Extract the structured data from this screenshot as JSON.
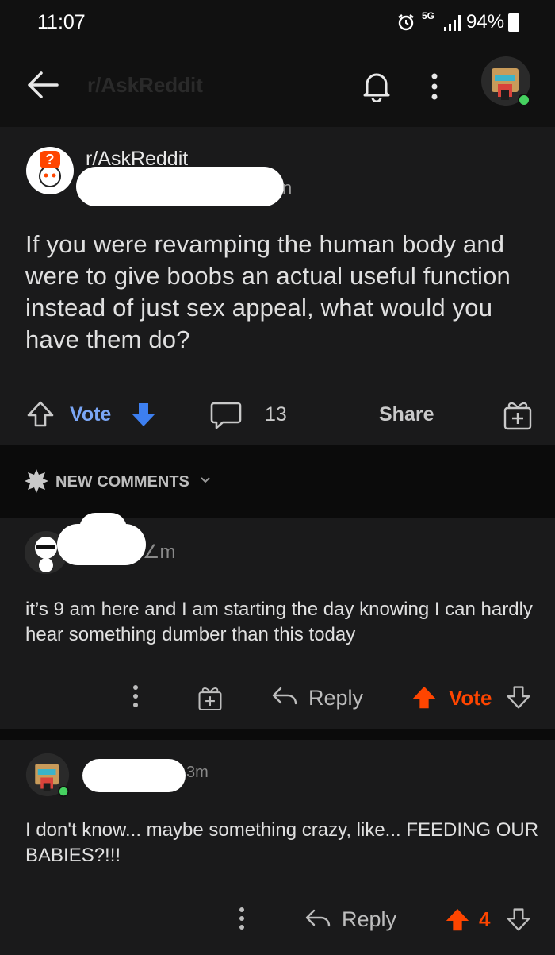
{
  "status_bar": {
    "time": "11:07",
    "network": "5G",
    "battery": "94%"
  },
  "header": {
    "subreddit_faded": "r/AskReddit"
  },
  "post": {
    "subreddit": "r/AskReddit",
    "username_suffix": "n",
    "title": "If you were revamping the human body and were to give boobs an actual useful function instead of just sex appeal, what would you have them do?",
    "vote_label": "Vote",
    "comment_count": "13",
    "share_label": "Share"
  },
  "sort": {
    "label": "NEW COMMENTS"
  },
  "comments": [
    {
      "age": "∠m",
      "text": "it’s 9 am here and I am starting the day knowing I can hardly hear something dumber than this today",
      "reply_label": "Reply",
      "vote_label": "Vote"
    },
    {
      "age": "3m",
      "text": "I don't know... maybe something crazy, like... FEEDING OUR BABIES?!!!",
      "reply_label": "Reply",
      "score": "4"
    }
  ],
  "colors": {
    "accent_blue": "#7aa6f5",
    "upvote_orange": "#ff4500",
    "online_green": "#46d160"
  }
}
